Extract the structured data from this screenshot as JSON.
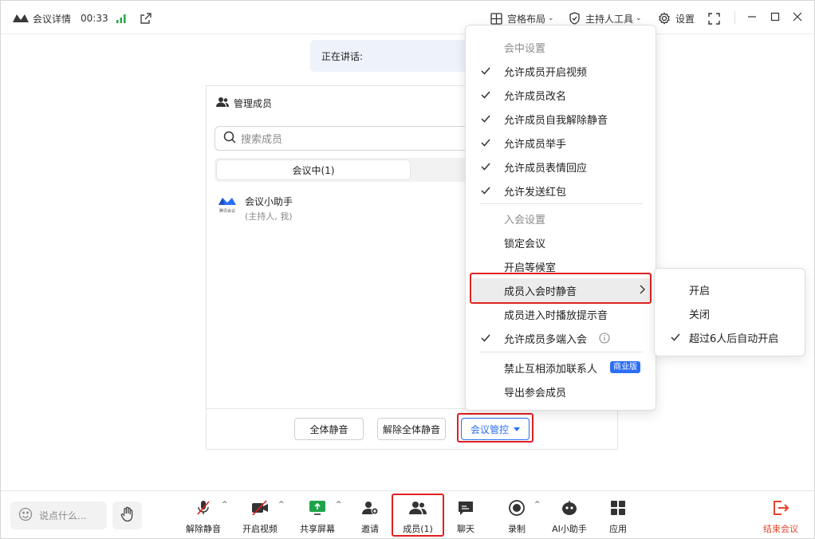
{
  "topbar": {
    "meeting_details": "会议详情",
    "timer": "00:33",
    "layout": "宫格布局",
    "host_tools": "主持人工具",
    "settings": "设置"
  },
  "speaking": {
    "label": "正在讲话:"
  },
  "panel": {
    "title": "管理成员",
    "search_placeholder": "搜索成员",
    "tab_in_meeting": "会议中(1)",
    "member": {
      "name": "会议小助手",
      "role": "(主持人, 我)",
      "logo_text": "腾讯会议"
    },
    "mute_all": "全体静音",
    "unmute_all": "解除全体静音",
    "meeting_control": "会议管控"
  },
  "menu": {
    "section_meeting": "会中设置",
    "items_meeting": [
      {
        "label": "允许成员开启视频",
        "checked": true
      },
      {
        "label": "允许成员改名",
        "checked": true
      },
      {
        "label": "允许成员自我解除静音",
        "checked": true
      },
      {
        "label": "允许成员举手",
        "checked": true
      },
      {
        "label": "允许成员表情回应",
        "checked": true
      },
      {
        "label": "允许发送红包",
        "checked": true
      }
    ],
    "section_join": "入会设置",
    "lock_meeting": "锁定会议",
    "waiting_room": "开启等候室",
    "mute_on_join": "成员入会时静音",
    "join_sound": "成员进入时播放提示音",
    "multi_device": "允许成员多端入会",
    "forbid_contacts": "禁止互相添加联系人",
    "business_badge": "商业版",
    "export_members": "导出参会成员"
  },
  "submenu": {
    "items": [
      {
        "label": "开启",
        "checked": false
      },
      {
        "label": "关闭",
        "checked": false
      },
      {
        "label": "超过6人后自动开启",
        "checked": true
      }
    ]
  },
  "bottombar": {
    "chat_placeholder": "说点什么...",
    "unmute": "解除静音",
    "start_video": "开启视频",
    "share_screen": "共享屏幕",
    "invite": "邀请",
    "members": "成员(1)",
    "chat": "聊天",
    "record": "录制",
    "ai_assistant": "AI小助手",
    "apps": "应用",
    "end_meeting": "结束会议"
  },
  "colors": {
    "accent": "#2b6ef5",
    "highlight_box": "#e02020",
    "signal_green": "#28a745",
    "end_red": "#e2452a"
  }
}
